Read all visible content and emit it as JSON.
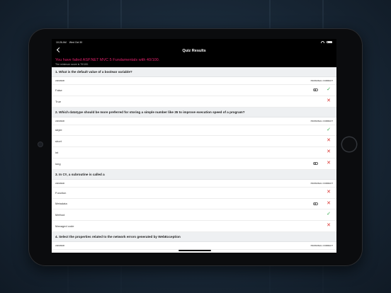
{
  "status_bar": {
    "time": "10:26 AM",
    "date": "Wed Oct 30",
    "battery_percent": 100
  },
  "nav": {
    "title": "Quiz Results"
  },
  "result": {
    "title": "You have failed ASP.NET MVC 5 Fundamentals with 40/100.",
    "subtitle": "The minimum score is 70/100."
  },
  "columns": {
    "answer": "ANSWER",
    "personal": "PERSONAL",
    "correct": "CORRECT"
  },
  "questions": [
    {
      "text": "1. What is the default value of a boolean variable?",
      "answers": [
        {
          "label": "False",
          "personal": true,
          "result": "correct"
        },
        {
          "label": "True",
          "personal": false,
          "result": "wrong"
        }
      ]
    },
    {
      "text": "2. Which datatype should be more preferred for storing a simple number like 35 to improve execution speed of a program?",
      "answers": [
        {
          "label": "sbyte",
          "personal": false,
          "result": "correct"
        },
        {
          "label": "short",
          "personal": false,
          "result": "wrong"
        },
        {
          "label": "int",
          "personal": false,
          "result": "wrong"
        },
        {
          "label": "long",
          "personal": true,
          "result": "wrong"
        }
      ]
    },
    {
      "text": "3. In C#, a subroutine is called a",
      "answers": [
        {
          "label": "Function",
          "personal": false,
          "result": "wrong"
        },
        {
          "label": "Metadata",
          "personal": true,
          "result": "wrong"
        },
        {
          "label": "Method",
          "personal": false,
          "result": "correct"
        },
        {
          "label": "Managed code",
          "personal": false,
          "result": "wrong"
        }
      ]
    },
    {
      "text": "4.  Select the properties related to the network errors generated by WebException",
      "answers": []
    }
  ],
  "icons": {
    "check": "✓",
    "cross": "✕"
  },
  "colors": {
    "fail_title": "#e0206b",
    "check": "#2ea84a",
    "cross": "#d9322e"
  }
}
